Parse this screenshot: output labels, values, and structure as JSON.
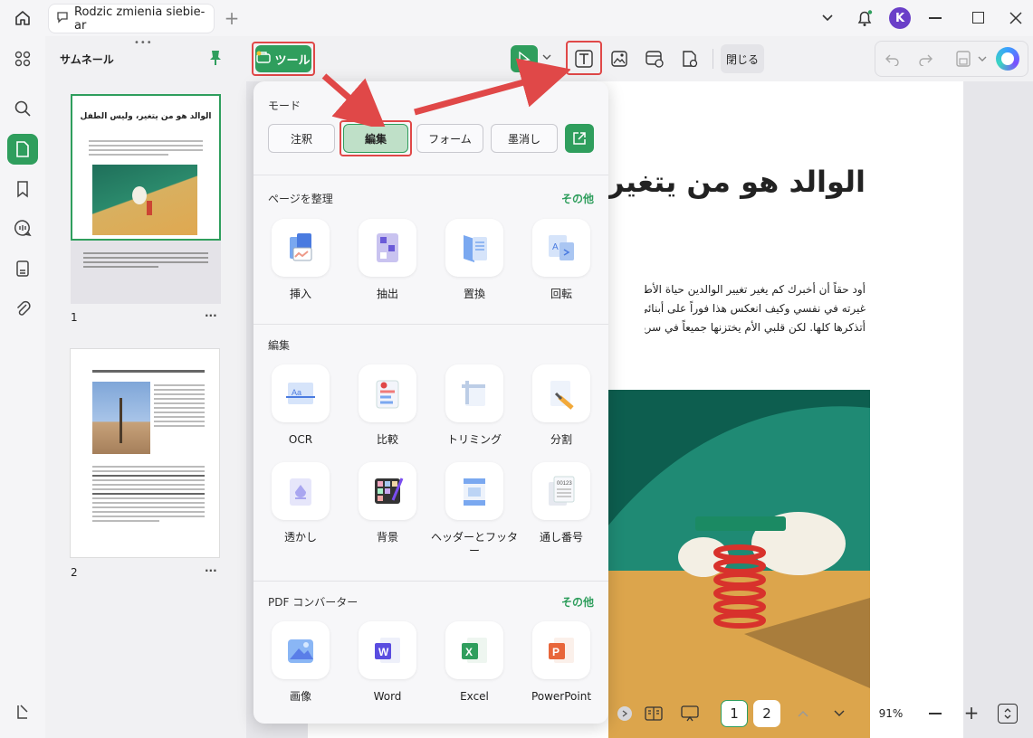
{
  "window": {
    "tab_title": "Rodzic zmienia siebie-ar",
    "avatar_letter": "K",
    "accent": "#2f9e5d",
    "highlight": "#e04848"
  },
  "sidebar": {
    "thumbnails_title": "サムネール",
    "pages": [
      {
        "number": "1"
      },
      {
        "number": "2"
      }
    ],
    "more_glyph": "···"
  },
  "toolbar": {
    "tools_label": "ツール",
    "close_label": "閉じる"
  },
  "tools_popup": {
    "mode_title": "モード",
    "modes": [
      "注釈",
      "編集",
      "フォーム",
      "墨消し"
    ],
    "active_mode": "編集",
    "organize": {
      "title": "ページを整理",
      "more": "その他",
      "items": [
        "挿入",
        "抽出",
        "置換",
        "回転"
      ]
    },
    "edit": {
      "title": "編集",
      "items": [
        "OCR",
        "比較",
        "トリミング",
        "分割",
        "透かし",
        "背景",
        "ヘッダーとフッター",
        "通し番号"
      ]
    },
    "converter": {
      "title": "PDF コンバーター",
      "more": "その他",
      "items": [
        "画像",
        "Word",
        "Excel",
        "PowerPoint"
      ]
    }
  },
  "document": {
    "heading": "الوالد هو من يتغير،",
    "paragraph_lines": [
      "أود حقاً أن أخبرك كم يغير تغيير الوالدين حياة الأطفال. ربما س",
      "غيرته في نفسي وكيف انعكس هذا فوراً على أبنائي. نعم، لقد ت",
      "أتذكرها كلها. لكن قلبي الأم يختزنها جميعاً في سرية."
    ]
  },
  "thumb1": {
    "title": "الوالد هو من يتغير، وليس الطفل"
  },
  "bottom": {
    "pages": [
      "1",
      "2"
    ],
    "zoom": "91%"
  }
}
